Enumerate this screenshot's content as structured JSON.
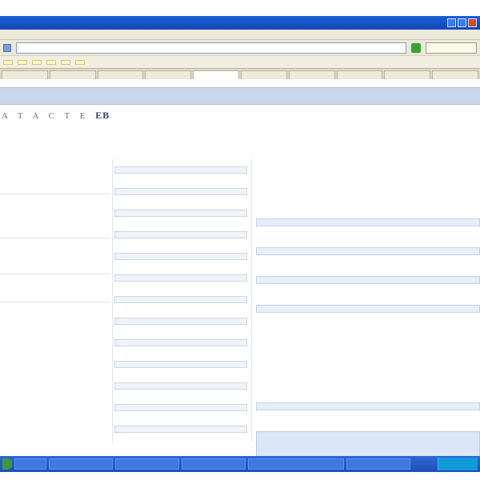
{
  "brand": {
    "prefix": "A T A C T E",
    "name": "EB"
  },
  "page": {
    "header": "",
    "subtitle": ""
  },
  "address": {
    "url": "",
    "search": ""
  },
  "colors": {
    "titlebar": "#1d5fd6",
    "page_header": "#c7d7ee",
    "taskbar": "#3168d5"
  },
  "icons": [
    "page-icon",
    "go-icon",
    "minimize-icon",
    "maximize-icon",
    "close-icon",
    "start-icon"
  ]
}
